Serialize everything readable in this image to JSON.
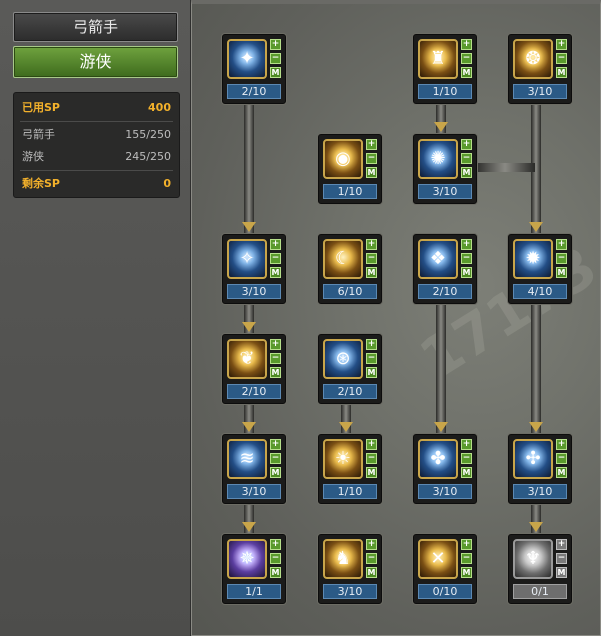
{
  "tabs": {
    "class": "弓箭手",
    "subclass": "游侠"
  },
  "sp": {
    "used_label": "已用SP",
    "used_value": "400",
    "rows": [
      {
        "label": "弓箭手",
        "value": "155/250"
      },
      {
        "label": "游侠",
        "value": "245/250"
      }
    ],
    "remaining_label": "剩余SP",
    "remaining_value": "0"
  },
  "buttons": {
    "plus": "+",
    "minus": "−",
    "master": "M"
  },
  "skills": [
    {
      "id": "r1c1",
      "level": "2/10",
      "icon": "skill-icon",
      "glyph": "✦",
      "style": "blue"
    },
    {
      "id": "r1c3",
      "level": "1/10",
      "icon": "skill-icon",
      "glyph": "♜",
      "style": "gold"
    },
    {
      "id": "r1c4",
      "level": "3/10",
      "icon": "skill-icon",
      "glyph": "❂",
      "style": "gold"
    },
    {
      "id": "r2c2",
      "level": "1/10",
      "icon": "skill-icon",
      "glyph": "◉",
      "style": "gold"
    },
    {
      "id": "r2c3",
      "level": "3/10",
      "icon": "skill-icon",
      "glyph": "✺",
      "style": "blue"
    },
    {
      "id": "r3c1",
      "level": "3/10",
      "icon": "skill-icon",
      "glyph": "✧",
      "style": "blue"
    },
    {
      "id": "r3c2",
      "level": "6/10",
      "icon": "skill-icon",
      "glyph": "☾",
      "style": "gold"
    },
    {
      "id": "r3c3",
      "level": "2/10",
      "icon": "skill-icon",
      "glyph": "❖",
      "style": "blue"
    },
    {
      "id": "r3c4",
      "level": "4/10",
      "icon": "skill-icon",
      "glyph": "✹",
      "style": "blue"
    },
    {
      "id": "r4c1",
      "level": "2/10",
      "icon": "skill-icon",
      "glyph": "❦",
      "style": "gold"
    },
    {
      "id": "r4c2",
      "level": "2/10",
      "icon": "skill-icon",
      "glyph": "⊛",
      "style": "blue"
    },
    {
      "id": "r5c1",
      "level": "3/10",
      "icon": "skill-icon",
      "glyph": "≋",
      "style": "blue"
    },
    {
      "id": "r5c2",
      "level": "1/10",
      "icon": "skill-icon",
      "glyph": "☀",
      "style": "gold"
    },
    {
      "id": "r5c3",
      "level": "3/10",
      "icon": "skill-icon",
      "glyph": "✤",
      "style": "blue"
    },
    {
      "id": "r5c4",
      "level": "3/10",
      "icon": "skill-icon",
      "glyph": "✣",
      "style": "blue"
    },
    {
      "id": "r6c1",
      "level": "1/1",
      "icon": "skill-icon",
      "glyph": "✵",
      "style": "purple"
    },
    {
      "id": "r6c2",
      "level": "3/10",
      "icon": "skill-icon",
      "glyph": "♞",
      "style": "gold"
    },
    {
      "id": "r6c3",
      "level": "0/10",
      "icon": "skill-icon",
      "glyph": "✕",
      "style": "gold"
    },
    {
      "id": "r6c4",
      "level": "0/1",
      "icon": "skill-icon",
      "glyph": "♆",
      "style": "grey"
    }
  ],
  "watermark": "17173"
}
